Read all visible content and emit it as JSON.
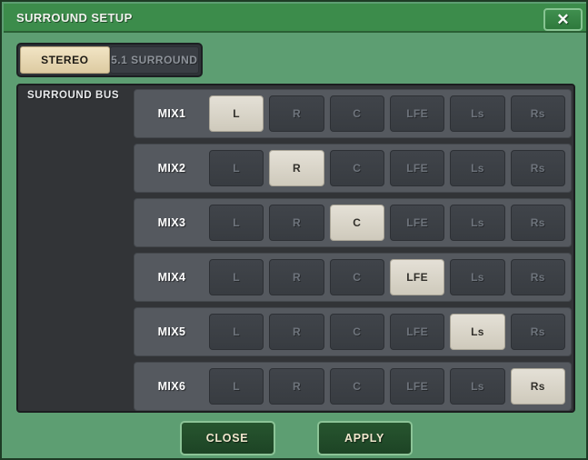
{
  "dialog": {
    "title": "SURROUND SETUP",
    "close_icon": "✕",
    "close_icon_name": "close-icon"
  },
  "mode_toggle": {
    "options": [
      {
        "label": "STEREO",
        "selected": true
      },
      {
        "label": "5.1 SURROUND",
        "selected": false
      }
    ]
  },
  "surround_bus": {
    "label": "SURROUND BUS",
    "channels": [
      "L",
      "R",
      "C",
      "LFE",
      "Ls",
      "Rs"
    ],
    "rows": [
      {
        "name": "MIX1",
        "selected": "L"
      },
      {
        "name": "MIX2",
        "selected": "R"
      },
      {
        "name": "MIX3",
        "selected": "C"
      },
      {
        "name": "MIX4",
        "selected": "LFE"
      },
      {
        "name": "MIX5",
        "selected": "Ls"
      },
      {
        "name": "MIX6",
        "selected": "Rs"
      }
    ]
  },
  "footer": {
    "close_label": "CLOSE",
    "apply_label": "APPLY"
  },
  "colors": {
    "dialog_bg": "#5d9e72",
    "titlebar_bg": "#3c8c4b",
    "panel_bg": "#323437",
    "row_bg": "#55595f",
    "button_on": "#e4e0d6",
    "button_off": "#40444a",
    "footer_button_bg": "#27552f",
    "footer_button_text": "#f0e7cd"
  }
}
